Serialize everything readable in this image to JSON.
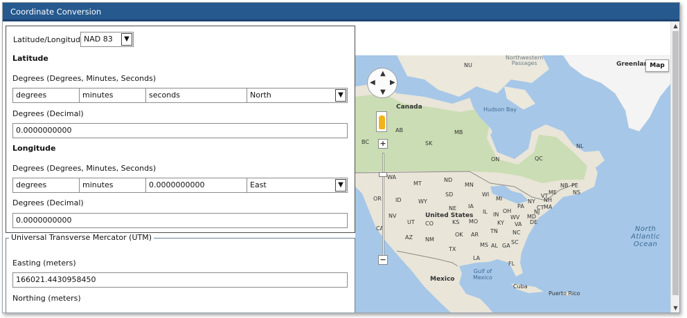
{
  "window": {
    "title": "Coordinate Conversion"
  },
  "latlon": {
    "label": "Latitude/Longitude",
    "datum": "NAD 83",
    "latitude": {
      "heading": "Latitude",
      "dms_label": "Degrees (Degrees, Minutes, Seconds)",
      "degrees": "degrees",
      "minutes": "minutes",
      "seconds": "seconds",
      "hemisphere": "North",
      "decimal_label": "Degrees (Decimal)",
      "decimal": "0.0000000000"
    },
    "longitude": {
      "heading": "Longitude",
      "dms_label": "Degrees (Degrees, Minutes, Seconds)",
      "degrees": "degrees",
      "minutes": "minutes",
      "seconds": "0.0000000000",
      "hemisphere": "East",
      "decimal_label": "Degrees (Decimal)",
      "decimal": "0.0000000000"
    }
  },
  "utm": {
    "legend": "Universal Transverse Mercator (UTM)",
    "easting_label": "Easting (meters)",
    "easting": "166021.4430958450",
    "northing_label": "Northing (meters)"
  },
  "map": {
    "type_button": "Map",
    "labels": {
      "greenland": "Greenland",
      "canada": "Canada",
      "hudson_bay": "Hudson Bay",
      "united_states": "United States",
      "mexico": "Mexico",
      "gulf": "Gulf of\nMexico",
      "cuba": "Cuba",
      "puerto_rico": "Puerto Rico",
      "nw_passages": "Northwestern\nPassages",
      "atlantic": "North\nAtlantic\nOcean",
      "nu": "NU",
      "bc": "BC",
      "ab": "AB",
      "sk": "SK",
      "mb": "MB",
      "on": "ON",
      "qc": "QC",
      "nl": "NL",
      "nb": "NB",
      "pe": "PE",
      "ns": "NS",
      "wa": "WA",
      "mt": "MT",
      "nd": "ND",
      "sd": "SD",
      "mn": "MN",
      "wi": "WI",
      "mi": "MI",
      "me": "ME",
      "vt": "VT",
      "nh": "NH",
      "ny": "NY",
      "ma": "MA",
      "or": "OR",
      "id": "ID",
      "wy": "WY",
      "ne": "NE",
      "ia": "IA",
      "il": "IL",
      "in": "IN",
      "oh": "OH",
      "pa": "PA",
      "nj": "NJ",
      "ct": "CT",
      "nv": "NV",
      "ut": "UT",
      "co": "CO",
      "ks": "KS",
      "mo": "MO",
      "ky": "KY",
      "wv": "WV",
      "va": "VA",
      "md": "MD",
      "de": "DE",
      "ca": "CA",
      "az": "AZ",
      "nm": "NM",
      "ok": "OK",
      "ar": "AR",
      "tn": "TN",
      "nc": "NC",
      "sc": "SC",
      "ms": "MS",
      "al": "AL",
      "ga": "GA",
      "tx": "TX",
      "la": "LA",
      "fl": "FL"
    }
  },
  "colors": {
    "titlebar": "#26598e",
    "water": "#a6c7e8",
    "land": "#e9e5d8",
    "forest": "#c6dcae",
    "ice": "#f4f4f4"
  }
}
